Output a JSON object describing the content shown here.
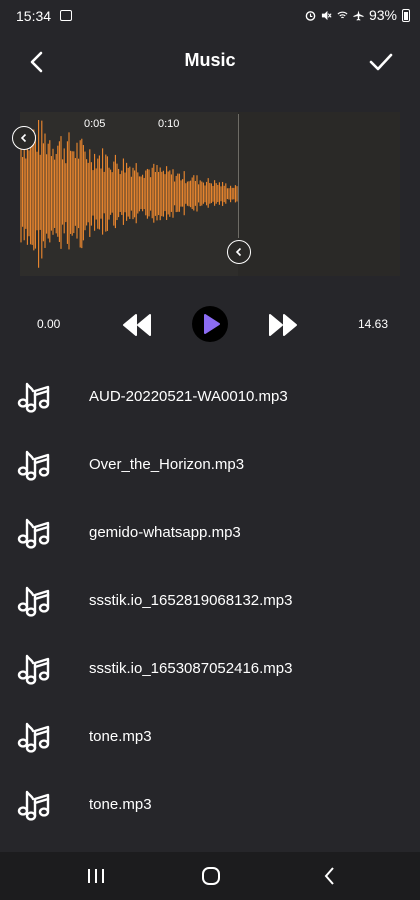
{
  "status": {
    "time": "15:34",
    "battery": "93%",
    "icons": [
      "gallery-icon",
      "alarm-icon",
      "mute-icon",
      "wifi-icon",
      "airplane-icon",
      "battery-icon"
    ]
  },
  "header": {
    "title": "Music",
    "back_icon": "back-arrow-icon",
    "confirm_icon": "check-icon"
  },
  "waveform": {
    "tick_labels": [
      "0:05",
      "0:10"
    ],
    "waveform_color": "#f08a2e",
    "selected_fraction": 0.57
  },
  "player": {
    "start_time": "0.00",
    "end_time": "14.63",
    "play_color": "#8b6cf3",
    "controls": [
      "rewind-icon",
      "play-icon",
      "fast-forward-icon"
    ]
  },
  "tracks": [
    {
      "name": "AUD-20220521-WA0010.mp3"
    },
    {
      "name": "Over_the_Horizon.mp3"
    },
    {
      "name": "gemido-whatsapp.mp3"
    },
    {
      "name": "ssstik.io_1652819068132.mp3"
    },
    {
      "name": "ssstik.io_1653087052416.mp3"
    },
    {
      "name": "tone.mp3"
    },
    {
      "name": "tone.mp3"
    }
  ],
  "navbar": {
    "buttons": [
      "recent-apps-icon",
      "home-icon",
      "back-icon"
    ]
  }
}
